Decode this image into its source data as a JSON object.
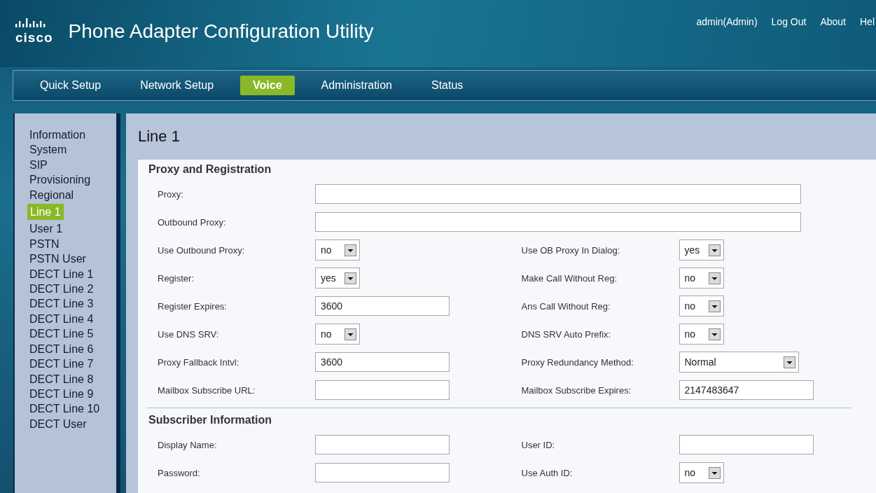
{
  "header": {
    "title": "Phone Adapter Configuration Utility",
    "logo_text": "cisco",
    "links": [
      "admin(Admin)",
      "Log Out",
      "About",
      "Hel"
    ]
  },
  "nav": [
    {
      "label": "Quick Setup",
      "selected": false
    },
    {
      "label": "Network Setup",
      "selected": false
    },
    {
      "label": "Voice",
      "selected": true
    },
    {
      "label": "Administration",
      "selected": false
    },
    {
      "label": "Status",
      "selected": false
    }
  ],
  "sidebar": [
    {
      "label": "Information",
      "selected": false
    },
    {
      "label": "System",
      "selected": false
    },
    {
      "label": "SIP",
      "selected": false
    },
    {
      "label": "Provisioning",
      "selected": false
    },
    {
      "label": "Regional",
      "selected": false
    },
    {
      "label": "Line 1",
      "selected": true
    },
    {
      "label": "User 1",
      "selected": false
    },
    {
      "label": "PSTN",
      "selected": false
    },
    {
      "label": "PSTN User",
      "selected": false
    },
    {
      "label": "DECT Line 1",
      "selected": false
    },
    {
      "label": "DECT Line 2",
      "selected": false
    },
    {
      "label": "DECT Line 3",
      "selected": false
    },
    {
      "label": "DECT Line 4",
      "selected": false
    },
    {
      "label": "DECT Line 5",
      "selected": false
    },
    {
      "label": "DECT Line 6",
      "selected": false
    },
    {
      "label": "DECT Line 7",
      "selected": false
    },
    {
      "label": "DECT Line 8",
      "selected": false
    },
    {
      "label": "DECT Line 9",
      "selected": false
    },
    {
      "label": "DECT Line 10",
      "selected": false
    },
    {
      "label": "DECT User",
      "selected": false
    }
  ],
  "page_title": "Line 1",
  "sections": [
    {
      "title": "Proxy and Registration",
      "rows": [
        {
          "fields": [
            {
              "label": "Proxy:",
              "kind": "long-text"
            }
          ]
        },
        {
          "fields": [
            {
              "label": "Outbound Proxy:",
              "kind": "long-text"
            }
          ]
        },
        {
          "fields": [
            {
              "label": "Use Outbound Proxy:",
              "kind": "select",
              "value": "no"
            },
            {
              "label": "Use OB Proxy In Dialog:",
              "kind": "select",
              "value": "yes"
            }
          ]
        },
        {
          "fields": [
            {
              "label": "Register:",
              "kind": "select",
              "value": "yes"
            },
            {
              "label": "Make Call Without Reg:",
              "kind": "select",
              "value": "no"
            }
          ]
        },
        {
          "fields": [
            {
              "label": "Register Expires:",
              "kind": "text",
              "value": "3600"
            },
            {
              "label": "Ans Call Without Reg:",
              "kind": "select",
              "value": "no"
            }
          ]
        },
        {
          "fields": [
            {
              "label": "Use DNS SRV:",
              "kind": "select",
              "value": "no"
            },
            {
              "label": "DNS SRV Auto Prefix:",
              "kind": "select",
              "value": "no"
            }
          ]
        },
        {
          "fields": [
            {
              "label": "Proxy Fallback Intvl:",
              "kind": "text",
              "value": "3600"
            },
            {
              "label": "Proxy Redundancy Method:",
              "kind": "wide-select",
              "value": "Normal"
            }
          ]
        },
        {
          "fields": [
            {
              "label": "Mailbox Subscribe URL:",
              "kind": "text"
            },
            {
              "label": "Mailbox Subscribe Expires:",
              "kind": "text",
              "value": "2147483647"
            }
          ]
        }
      ]
    },
    {
      "title": "Subscriber Information",
      "rows": [
        {
          "fields": [
            {
              "label": "Display Name:",
              "kind": "text"
            },
            {
              "label": "User ID:",
              "kind": "text"
            }
          ]
        },
        {
          "fields": [
            {
              "label": "Password:",
              "kind": "text"
            },
            {
              "label": "Use Auth ID:",
              "kind": "select",
              "value": "no"
            }
          ]
        }
      ]
    }
  ]
}
